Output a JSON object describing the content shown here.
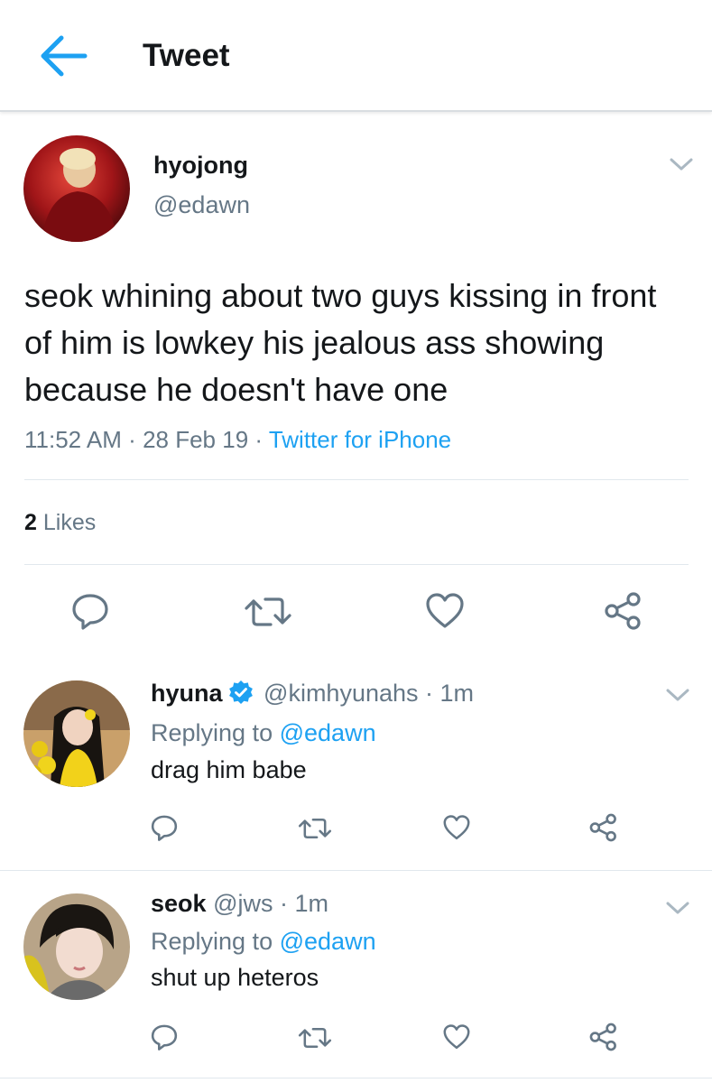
{
  "header": {
    "title": "Tweet"
  },
  "tweet": {
    "name": "hyojong",
    "handle": "@edawn",
    "text": "seok whining about two guys kissing in front of him is lowkey his jealous ass showing because he doesn't have one",
    "time": "11:52 AM",
    "date": "28 Feb 19",
    "source": "Twitter for iPhone",
    "like_count": "2",
    "like_label": "Likes"
  },
  "replies": [
    {
      "name": "hyuna",
      "verified": true,
      "handle": "@kimhyunahs",
      "age": "1m",
      "replying_prefix": "Replying to",
      "replying_to": "@edawn",
      "text": "drag him babe"
    },
    {
      "name": "seok",
      "verified": false,
      "handle": "@jws",
      "age": "1m",
      "replying_prefix": "Replying to",
      "replying_to": "@edawn",
      "text": "shut up heteros"
    }
  ],
  "icons": {
    "back": "back-arrow-icon",
    "menu": "chevron-down-icon",
    "reply": "reply-icon",
    "retweet": "retweet-icon",
    "like": "heart-icon",
    "share": "share-icon",
    "verified": "verified-badge-icon"
  },
  "colors": {
    "accent": "#1da1f2",
    "text": "#14171a",
    "muted": "#657786",
    "divider": "#e1e8ed"
  }
}
